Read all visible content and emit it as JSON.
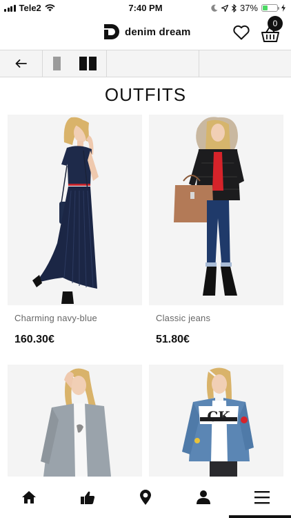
{
  "status_bar": {
    "carrier": "Tele2",
    "time": "7:40 PM",
    "battery": "37%",
    "battery_level": 0.37
  },
  "header": {
    "brand": "denim dream",
    "cart_count": "0"
  },
  "page_title": "OUTFITS",
  "products": [
    {
      "name": "Charming navy-blue",
      "price": "160.30€"
    },
    {
      "name": "Classic jeans",
      "price": "51.80€"
    },
    {
      "name": "",
      "price": ""
    },
    {
      "name": "",
      "price": ""
    }
  ],
  "icons": {
    "status": [
      "signal-bars-icon",
      "wifi-icon",
      "moon-icon",
      "location-arrow-icon",
      "bluetooth-icon",
      "battery-icon",
      "charging-bolt-icon"
    ],
    "header": [
      "denim-dream-logo",
      "heart-icon",
      "shopping-basket-icon"
    ],
    "toolbar": [
      "back-arrow-icon",
      "single-column-view-icon",
      "two-column-view-icon"
    ],
    "bottom_nav": [
      "home-icon",
      "thumbs-up-icon",
      "map-pin-icon",
      "user-icon",
      "menu-icon"
    ]
  },
  "colors": {
    "battery": "#4cd964",
    "toolbar_bg": "#f4f4f4",
    "active_view": "#111111",
    "inactive_view": "#9b9b9b"
  }
}
